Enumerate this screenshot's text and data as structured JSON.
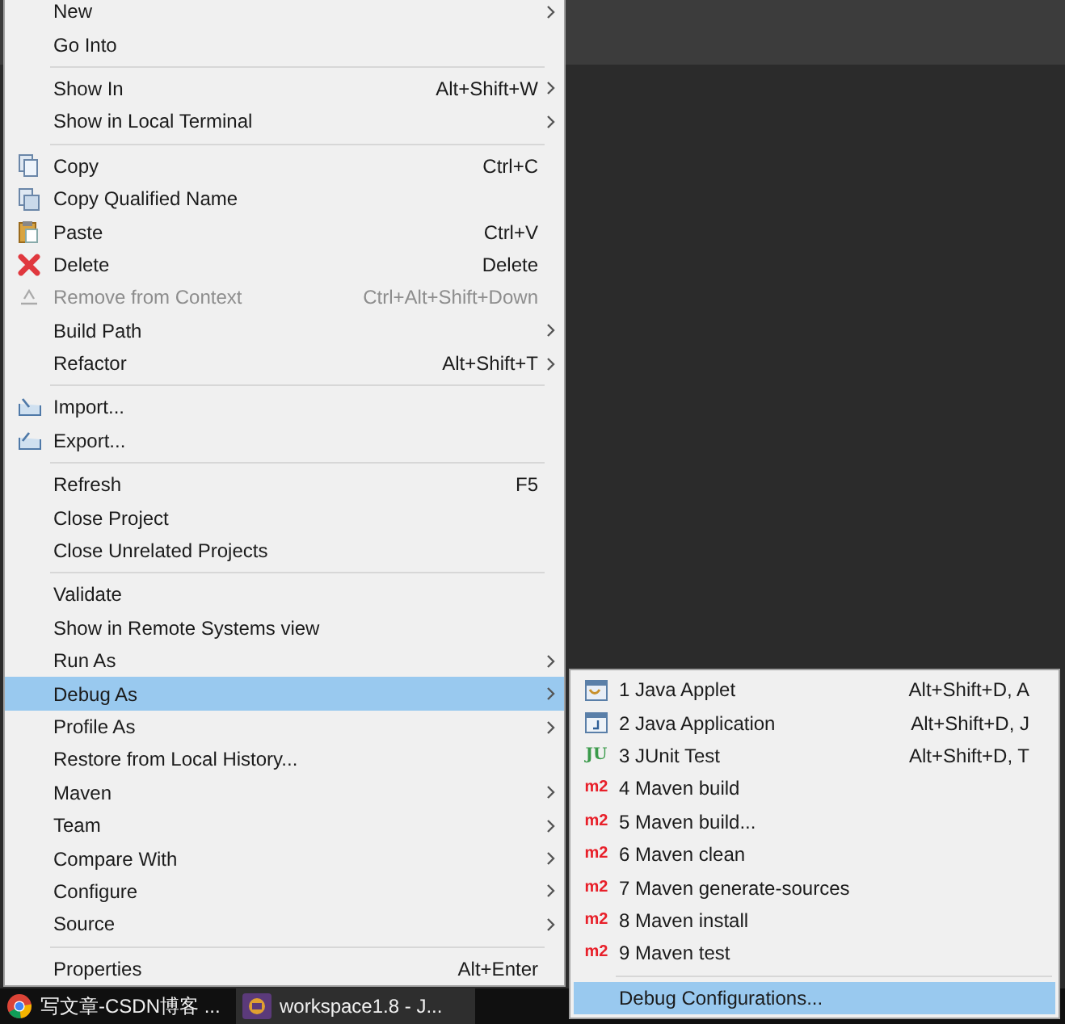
{
  "context_menu": {
    "items": [
      {
        "kind": "item",
        "label": "New",
        "submenu": true,
        "disabled": false,
        "selected": false
      },
      {
        "kind": "item",
        "label": "Go Into",
        "submenu": false,
        "disabled": false,
        "selected": false
      },
      {
        "kind": "separator"
      },
      {
        "kind": "item",
        "label": "Show In",
        "shortcut": "Alt+Shift+W",
        "submenu": true,
        "disabled": false,
        "selected": false
      },
      {
        "kind": "item",
        "label": "Show in Local Terminal",
        "submenu": true,
        "disabled": false,
        "selected": false
      },
      {
        "kind": "separator"
      },
      {
        "kind": "item",
        "label": "Copy",
        "shortcut": "Ctrl+C",
        "submenu": false,
        "disabled": false,
        "selected": false
      },
      {
        "kind": "item",
        "label": "Copy Qualified Name",
        "submenu": false,
        "disabled": false,
        "selected": false
      },
      {
        "kind": "item",
        "label": "Paste",
        "shortcut": "Ctrl+V",
        "submenu": false,
        "disabled": false,
        "selected": false
      },
      {
        "kind": "item",
        "label": "Delete",
        "shortcut": "Delete",
        "submenu": false,
        "disabled": false,
        "selected": false
      },
      {
        "kind": "item",
        "label": "Remove from Context",
        "shortcut": "Ctrl+Alt+Shift+Down",
        "submenu": false,
        "disabled": true,
        "selected": false
      },
      {
        "kind": "item",
        "label": "Build Path",
        "submenu": true,
        "disabled": false,
        "selected": false
      },
      {
        "kind": "item",
        "label": "Refactor",
        "shortcut": "Alt+Shift+T",
        "submenu": true,
        "disabled": false,
        "selected": false
      },
      {
        "kind": "separator"
      },
      {
        "kind": "item",
        "label": "Import...",
        "submenu": false,
        "disabled": false,
        "selected": false
      },
      {
        "kind": "item",
        "label": "Export...",
        "submenu": false,
        "disabled": false,
        "selected": false
      },
      {
        "kind": "separator"
      },
      {
        "kind": "item",
        "label": "Refresh",
        "shortcut": "F5",
        "submenu": false,
        "disabled": false,
        "selected": false
      },
      {
        "kind": "item",
        "label": "Close Project",
        "submenu": false,
        "disabled": false,
        "selected": false
      },
      {
        "kind": "item",
        "label": "Close Unrelated Projects",
        "submenu": false,
        "disabled": false,
        "selected": false
      },
      {
        "kind": "separator"
      },
      {
        "kind": "item",
        "label": "Validate",
        "submenu": false,
        "disabled": false,
        "selected": false
      },
      {
        "kind": "item",
        "label": "Show in Remote Systems view",
        "submenu": false,
        "disabled": false,
        "selected": false
      },
      {
        "kind": "item",
        "label": "Run As",
        "submenu": true,
        "disabled": false,
        "selected": false
      },
      {
        "kind": "item",
        "label": "Debug As",
        "submenu": true,
        "disabled": false,
        "selected": true
      },
      {
        "kind": "item",
        "label": "Profile As",
        "submenu": true,
        "disabled": false,
        "selected": false
      },
      {
        "kind": "item",
        "label": "Restore from Local History...",
        "submenu": false,
        "disabled": false,
        "selected": false
      },
      {
        "kind": "item",
        "label": "Maven",
        "submenu": true,
        "disabled": false,
        "selected": false
      },
      {
        "kind": "item",
        "label": "Team",
        "submenu": true,
        "disabled": false,
        "selected": false
      },
      {
        "kind": "item",
        "label": "Compare With",
        "submenu": true,
        "disabled": false,
        "selected": false
      },
      {
        "kind": "item",
        "label": "Configure",
        "submenu": true,
        "disabled": false,
        "selected": false
      },
      {
        "kind": "item",
        "label": "Source",
        "submenu": true,
        "disabled": false,
        "selected": false
      },
      {
        "kind": "separator"
      },
      {
        "kind": "item",
        "label": "Properties",
        "shortcut": "Alt+Enter",
        "submenu": false,
        "disabled": false,
        "selected": false
      }
    ]
  },
  "debug_as_submenu": {
    "items": [
      {
        "kind": "item",
        "label": "1 Java Applet",
        "shortcut": "Alt+Shift+D, A",
        "selected": false
      },
      {
        "kind": "item",
        "label": "2 Java Application",
        "shortcut": "Alt+Shift+D, J",
        "selected": false
      },
      {
        "kind": "item",
        "badge": "JU",
        "label": "3 JUnit Test",
        "shortcut": "Alt+Shift+D, T",
        "selected": false
      },
      {
        "kind": "item",
        "badge": "m2",
        "label": "4 Maven build",
        "selected": false
      },
      {
        "kind": "item",
        "badge": "m2",
        "label": "5 Maven build...",
        "selected": false
      },
      {
        "kind": "item",
        "badge": "m2",
        "label": "6 Maven clean",
        "selected": false
      },
      {
        "kind": "item",
        "badge": "m2",
        "label": "7 Maven generate-sources",
        "selected": false
      },
      {
        "kind": "item",
        "badge": "m2",
        "label": "8 Maven install",
        "selected": false
      },
      {
        "kind": "item",
        "badge": "m2",
        "label": "9 Maven test",
        "selected": false
      },
      {
        "kind": "separator"
      },
      {
        "kind": "item",
        "label": "Debug Configurations...",
        "selected": true
      }
    ]
  },
  "taskbar": {
    "items": [
      {
        "label": "写文章-CSDN博客 ...",
        "selected": false
      },
      {
        "label": "workspace1.8 - J...",
        "selected": true
      }
    ]
  }
}
